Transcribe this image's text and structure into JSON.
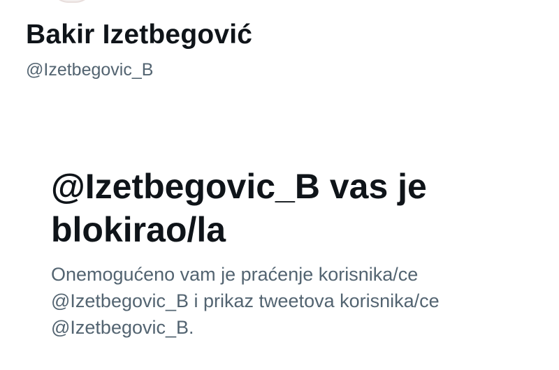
{
  "profile": {
    "name": "Bakir Izetbegović",
    "handle": "@Izetbegovic_B"
  },
  "blocked": {
    "title_line1": "@Izetbegovic_B vas je",
    "title_line2": "blokirao/la",
    "description": "Onemogućeno vam je praćenje korisnika/ce @Izetbegovic_B i prikaz tweetova korisnika/ce @Izetbegovic_B."
  }
}
